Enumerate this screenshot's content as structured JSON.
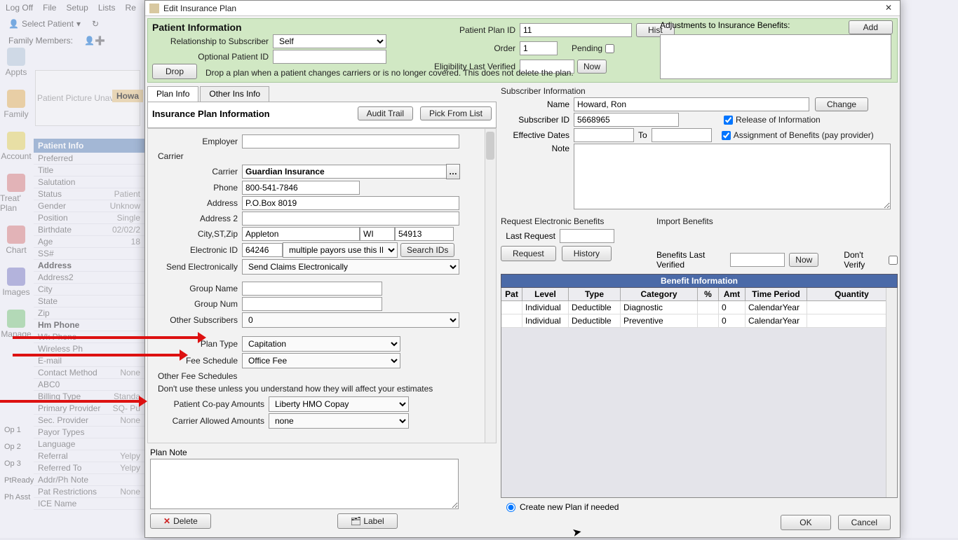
{
  "bg": {
    "menu": [
      "Log Off",
      "File",
      "Setup",
      "Lists",
      "Re"
    ],
    "toolbar": {
      "select": "Select Patient",
      "family": "Family Members:"
    },
    "sidebar": [
      {
        "label": "Appts"
      },
      {
        "label": "Family"
      },
      {
        "label": "Account"
      },
      {
        "label": "Treat' Plan"
      },
      {
        "label": "Chart"
      },
      {
        "label": "Images"
      },
      {
        "label": "Manage"
      }
    ],
    "ops": [
      "Op 1",
      "Op 2",
      "Op 3",
      "PtReady",
      "Ph Asst"
    ],
    "patient_card": "Patient Picture Unavailable",
    "howard": "Howa",
    "patient_header": "Patient Info",
    "rows": [
      [
        "Preferred",
        ""
      ],
      [
        "Title",
        ""
      ],
      [
        "Salutation",
        ""
      ],
      [
        "Status",
        "Patient"
      ],
      [
        "Gender",
        "Unknow"
      ],
      [
        "Position",
        "Single"
      ],
      [
        "Birthdate",
        "02/02/2"
      ],
      [
        "Age",
        "18"
      ],
      [
        "SS#",
        ""
      ],
      [
        "Address",
        ""
      ],
      [
        "Address2",
        ""
      ],
      [
        "City",
        ""
      ],
      [
        "State",
        ""
      ],
      [
        "Zip",
        ""
      ],
      [
        "Hm Phone",
        ""
      ],
      [
        "Wk Phone",
        ""
      ],
      [
        "Wireless Ph",
        ""
      ],
      [
        "E-mail",
        ""
      ],
      [
        "Contact Method",
        "None"
      ],
      [
        "ABC0",
        ""
      ],
      [
        "Billing Type",
        "Standa"
      ],
      [
        "Primary Provider",
        "SQ- Pu"
      ],
      [
        "Sec. Provider",
        "None"
      ],
      [
        "Payor Types",
        ""
      ],
      [
        "Language",
        ""
      ],
      [
        "Referral",
        "Yelpy"
      ],
      [
        "Referred To",
        "Yelpy"
      ],
      [
        "Addr/Ph Note",
        ""
      ],
      [
        "Pat Restrictions",
        "None"
      ],
      [
        "ICE Name",
        ""
      ]
    ]
  },
  "modal": {
    "title": "Edit Insurance Plan",
    "close": "✕"
  },
  "pi": {
    "title": "Patient Information",
    "rel_label": "Relationship to Subscriber",
    "rel_value": "Self",
    "opt_label": "Optional Patient ID",
    "planid_label": "Patient Plan ID",
    "planid_value": "11",
    "hist": "Hist",
    "order_label": "Order",
    "order_value": "1",
    "pending": "Pending",
    "elig_label": "Eligibility Last Verified",
    "now": "Now",
    "drop": "Drop",
    "drop_text": "Drop a plan when a patient changes carriers or is no longer covered.  This does not delete the plan.",
    "adjust_label": "Adjustments to Insurance Benefits:",
    "add": "Add"
  },
  "tabs": {
    "t1": "Plan Info",
    "t2": "Other Ins Info"
  },
  "ipi": {
    "title": "Insurance Plan Information",
    "audit": "Audit Trail",
    "pick": "Pick From List",
    "employer_label": "Employer",
    "carrier_group": "Carrier",
    "carrier_label": "Carrier",
    "carrier_value": "Guardian Insurance",
    "phone_label": "Phone",
    "phone_value": "800-541-7846",
    "address_label": "Address",
    "address_value": "P.O.Box 8019",
    "address2_label": "Address 2",
    "csz_label": "City,ST,Zip",
    "city": "Appleton",
    "st": "WI",
    "zip": "54913",
    "eid_label": "Electronic ID",
    "eid_value": "64246",
    "eid_sel": "multiple payors use this ID",
    "searchids": "Search IDs",
    "sendel_label": "Send Electronically",
    "sendel_value": "Send Claims Electronically",
    "groupname_label": "Group Name",
    "groupnum_label": "Group Num",
    "othersubs_label": "Other Subscribers",
    "othersubs_value": "0",
    "plantype_label": "Plan Type",
    "plantype_value": "Capitation",
    "feesched_label": "Fee Schedule",
    "feesched_value": "Office Fee",
    "otherfee_label": "Other Fee Schedules",
    "otherfee_note": "Don't use these unless you understand how they will affect your estimates",
    "copay_label": "Patient Co-pay Amounts",
    "copay_value": "Liberty HMO Copay",
    "allowed_label": "Carrier Allowed Amounts",
    "allowed_value": "none",
    "plannote_label": "Plan Note",
    "delete": "Delete",
    "label_btn": "Label"
  },
  "sub": {
    "title": "Subscriber Information",
    "name_label": "Name",
    "name_value": "Howard, Ron",
    "change": "Change",
    "id_label": "Subscriber ID",
    "id_value": "5668965",
    "eff_label": "Effective Dates",
    "to": "To",
    "release": "Release of Information",
    "assign": "Assignment of Benefits (pay provider)",
    "note_label": "Note"
  },
  "req": {
    "title": "Request Electronic Benefits",
    "last_label": "Last Request",
    "request": "Request",
    "history": "History",
    "import_title": "Import Benefits",
    "lastver_label": "Benefits Last Verified",
    "now": "Now",
    "dontverify": "Don't Verify"
  },
  "benefits": {
    "title": "Benefit Information",
    "headers": [
      "Pat",
      "Level",
      "Type",
      "Category",
      "%",
      "Amt",
      "Time Period",
      "Quantity"
    ],
    "rows": [
      {
        "pat": "",
        "level": "Individual",
        "type": "Deductible",
        "cat": "Diagnostic",
        "pct": "",
        "amt": "0",
        "tp": "CalendarYear",
        "qty": ""
      },
      {
        "pat": "",
        "level": "Individual",
        "type": "Deductible",
        "cat": "Preventive",
        "pct": "",
        "amt": "0",
        "tp": "CalendarYear",
        "qty": ""
      }
    ]
  },
  "footer": {
    "radio": "Create new Plan if needed",
    "ok": "OK",
    "cancel": "Cancel"
  }
}
